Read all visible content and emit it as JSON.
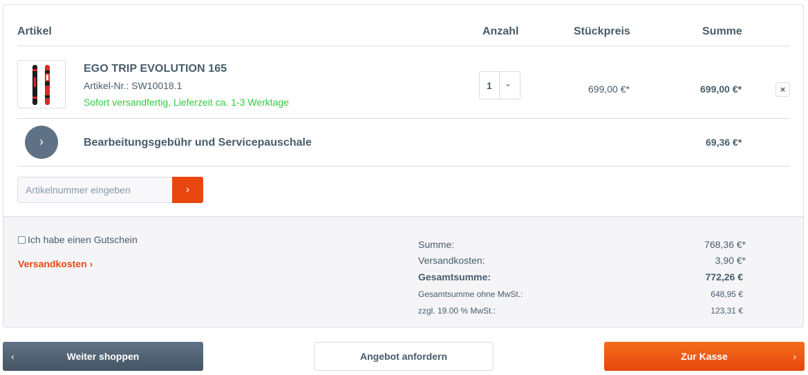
{
  "table_header": {
    "artikel": "Artikel",
    "anzahl": "Anzahl",
    "stueckpreis": "Stückpreis",
    "summe": "Summe"
  },
  "product": {
    "name": "EGO TRIP EVOLUTION 165",
    "sku": "Artikel-Nr.: SW10018.1",
    "delivery": "Sofort versandfertig, Lieferzeit ca. 1-3 Werktage",
    "quantity": "1",
    "unit_price": "699,00 €*",
    "total": "699,00 €*",
    "remove_icon": "×",
    "image_icon": "ski-pair-image",
    "delivery_color": "#2ecc40"
  },
  "fee": {
    "label": "Bearbeitungsgebühr und Servicepauschale",
    "total": "69,36 €*",
    "icon": "›"
  },
  "add_article": {
    "placeholder": "Artikelnummer eingeben",
    "button_icon": "›"
  },
  "summary": {
    "voucher_label": "Ich habe einen Gutschein",
    "shipping_link": "Versandkosten ›",
    "rows": [
      {
        "label": "Summe:",
        "value": "768,36 €*"
      },
      {
        "label": "Versandkosten:",
        "value": "3,90 €*"
      },
      {
        "label": "Gesamtsumme:",
        "value": "772,26 €"
      },
      {
        "label": "Gesamtsumme ohne MwSt.:",
        "value": "648,95 €"
      },
      {
        "label": "zzgl. 19.00 % MwSt.:",
        "value": "123,31 €"
      }
    ]
  },
  "buttons": {
    "continue": "Weiter shoppen",
    "continue_icon": "‹",
    "offer": "Angebot anfordern",
    "checkout": "Zur Kasse",
    "checkout_icon": "›"
  },
  "colors": {
    "accent": "#e8470f",
    "text": "#475c6a",
    "secondary": "#5f7285",
    "border": "#dadae5"
  }
}
